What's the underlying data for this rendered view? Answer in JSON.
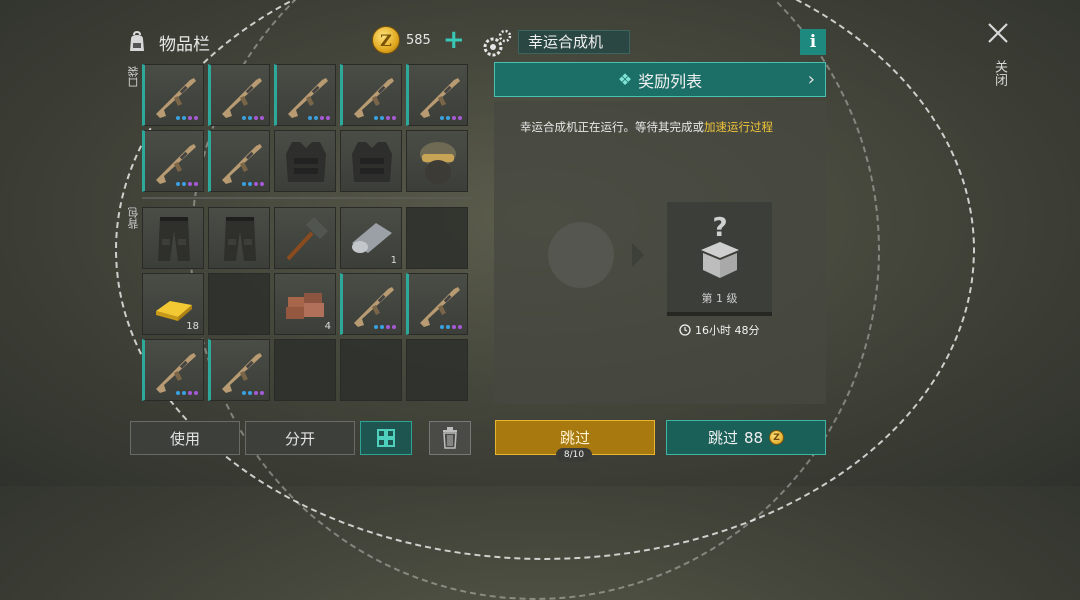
{
  "inventory": {
    "title": "物品栏",
    "coins": "585",
    "plus": "+",
    "pocket_label": "口袋",
    "backpack_label": "背包",
    "pocket_slots": [
      {
        "type": "rifle"
      },
      {
        "type": "rifle"
      },
      {
        "type": "rifle"
      },
      {
        "type": "rifle"
      },
      {
        "type": "rifle"
      },
      {
        "type": "rifle"
      },
      {
        "type": "rifle"
      },
      {
        "type": "vest"
      },
      {
        "type": "vest"
      },
      {
        "type": "helmet"
      }
    ],
    "backpack_slots": [
      {
        "type": "pants"
      },
      {
        "type": "pants"
      },
      {
        "type": "shovel"
      },
      {
        "type": "cloth",
        "qty": "1"
      },
      {
        "type": "empty"
      },
      {
        "type": "gold",
        "qty": "18"
      },
      {
        "type": "empty"
      },
      {
        "type": "bricks",
        "qty": "4"
      },
      {
        "type": "rifle"
      },
      {
        "type": "rifle"
      },
      {
        "type": "rifle"
      },
      {
        "type": "rifle"
      },
      {
        "type": "empty"
      },
      {
        "type": "empty"
      },
      {
        "type": "empty"
      }
    ],
    "use_label": "使用",
    "split_label": "分开"
  },
  "machine": {
    "title": "幸运合成机",
    "info": "i",
    "reward_list_label": "奖励列表",
    "status_prefix": "幸运合成机正在运行。等待其完成或",
    "status_link": "加速运行过程",
    "reward_level": "第 1 级",
    "timer": "16小时 48分",
    "skip_label": "跳过",
    "skip_count": "8/10",
    "skip_paid_label": "跳过",
    "skip_paid_cost": "88"
  },
  "close_label": "关闭",
  "colors": {
    "accent_teal": "#1c6f67",
    "gold": "#a8790e",
    "link_yellow": "#f0c63a"
  }
}
